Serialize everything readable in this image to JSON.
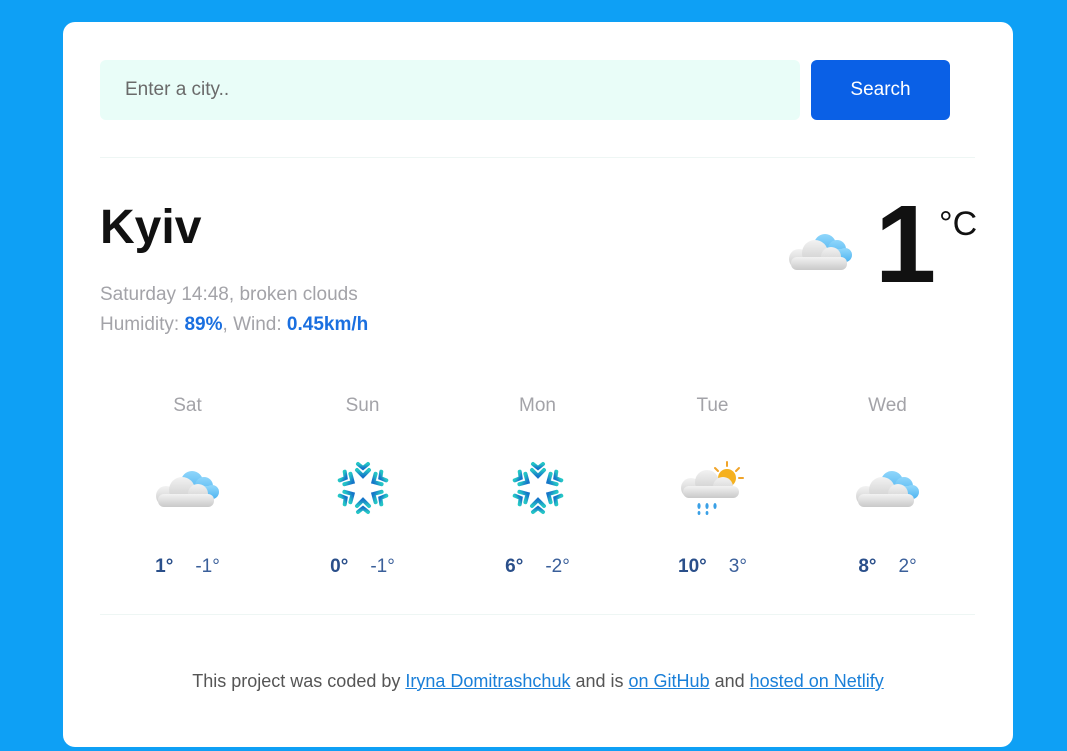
{
  "search": {
    "placeholder": "Enter a city..",
    "button_label": "Search"
  },
  "current": {
    "city": "Kyiv",
    "datetime": "Saturday 14:48",
    "description": "broken clouds",
    "humidity_label": "Humidity:",
    "humidity_value": "89%",
    "wind_label": "Wind:",
    "wind_value": "0.45km/h",
    "temperature": "1",
    "unit": "°C",
    "icon": "broken-clouds-icon"
  },
  "forecast": [
    {
      "day": "Sat",
      "icon": "broken-clouds-icon",
      "max": "1°",
      "min": "-1°"
    },
    {
      "day": "Sun",
      "icon": "snowflake-icon",
      "max": "0°",
      "min": "-1°"
    },
    {
      "day": "Mon",
      "icon": "snowflake-icon",
      "max": "6°",
      "min": "-2°"
    },
    {
      "day": "Tue",
      "icon": "rain-sun-cloud-icon",
      "max": "10°",
      "min": "3°"
    },
    {
      "day": "Wed",
      "icon": "broken-clouds-icon",
      "max": "8°",
      "min": "2°"
    }
  ],
  "footer": {
    "text1": "This project was coded by",
    "author": "Iryna Domitrashchuk",
    "text2": "and is",
    "github": "on GitHub",
    "text3": "and",
    "netlify": "hosted on Netlify"
  },
  "colors": {
    "background": "#0ea0f5",
    "accent": "#0a60e6",
    "input_bg": "#e9fdf8"
  }
}
